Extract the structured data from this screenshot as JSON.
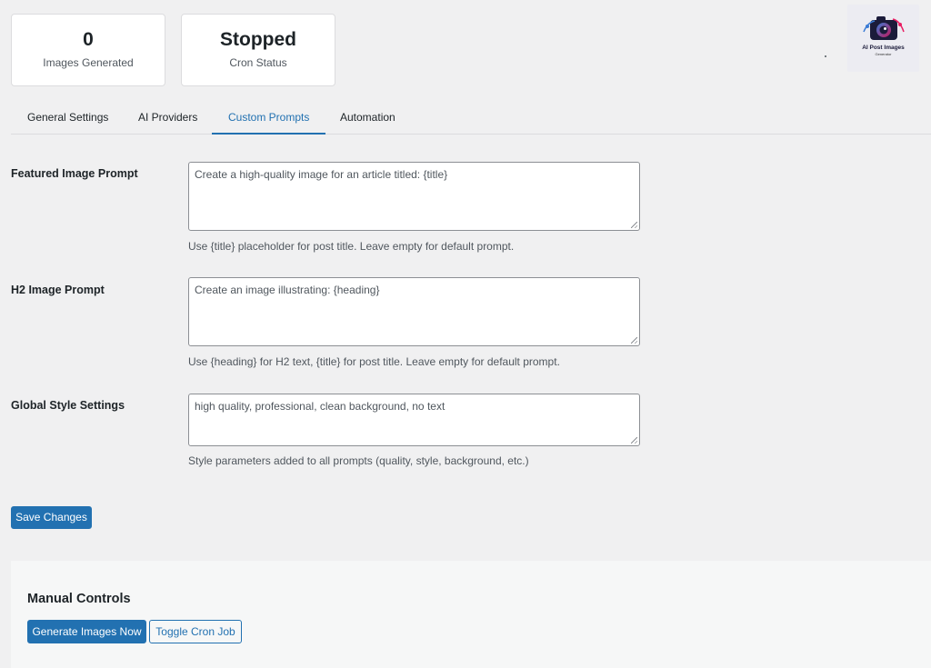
{
  "stats": {
    "images_generated": {
      "value": "0",
      "label": "Images Generated"
    },
    "cron_status": {
      "value": "Stopped",
      "label": "Cron Status"
    }
  },
  "logo": {
    "title": "AI Post Images",
    "subtitle": "Generator"
  },
  "tabs": [
    {
      "label": "General Settings",
      "active": false
    },
    {
      "label": "AI Providers",
      "active": false
    },
    {
      "label": "Custom Prompts",
      "active": true
    },
    {
      "label": "Automation",
      "active": false
    }
  ],
  "fields": {
    "featured": {
      "label": "Featured Image Prompt",
      "value": "Create a high-quality image for an article titled: {title}",
      "help": "Use {title} placeholder for post title. Leave empty for default prompt."
    },
    "h2": {
      "label": "H2 Image Prompt",
      "value": "Create an image illustrating: {heading}",
      "help": "Use {heading} for H2 text, {title} for post title. Leave empty for default prompt."
    },
    "style": {
      "label": "Global Style Settings",
      "value": "high quality, professional, clean background, no text",
      "help": "Style parameters added to all prompts (quality, style, background, etc.)"
    }
  },
  "save_button": {
    "label": "Save Changes"
  },
  "manual_controls": {
    "title": "Manual Controls",
    "generate_label": "Generate Images Now",
    "toggle_label": "Toggle Cron Job"
  },
  "colors": {
    "accent": "#2271b1",
    "background": "#f0f0f1",
    "panel": "#f6f7f7"
  }
}
